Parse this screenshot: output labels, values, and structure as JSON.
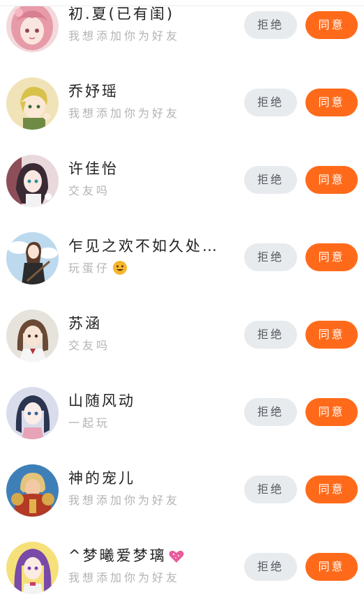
{
  "requests": [
    {
      "name": "初.夏(已有闺)",
      "message": "我想添加你为好友",
      "avatar": "pink-hair-girl-avatar",
      "reject_label": "拒绝",
      "accept_label": "同意"
    },
    {
      "name": "乔妤瑶",
      "message": "我想添加你为好友",
      "avatar": "blonde-boy-avatar",
      "reject_label": "拒绝",
      "accept_label": "同意"
    },
    {
      "name": "许佳怡",
      "message": "交友吗",
      "avatar": "dark-hair-girl-avatar",
      "reject_label": "拒绝",
      "accept_label": "同意"
    },
    {
      "name": "乍见之欢不如久处…",
      "message": "玩蛋仔",
      "message_emoji": "smiling-face-emoji",
      "avatar": "girl-with-guitar-avatar",
      "reject_label": "拒绝",
      "accept_label": "同意"
    },
    {
      "name": "苏涵",
      "message": "交友吗",
      "avatar": "brown-hair-girl-avatar",
      "reject_label": "拒绝",
      "accept_label": "同意"
    },
    {
      "name": "山随风动",
      "message": "一起玩",
      "avatar": "anime-girl-blue-hair-avatar",
      "reject_label": "拒绝",
      "accept_label": "同意"
    },
    {
      "name": "神的宠儿",
      "message": "我想添加你为好友",
      "avatar": "armored-warrior-avatar",
      "reject_label": "拒绝",
      "accept_label": "同意"
    },
    {
      "name": "^梦曦爱梦璃",
      "name_emoji": "sparkling-heart-emoji",
      "message": "我想添加你为好友",
      "avatar": "purple-hair-girl-avatar",
      "reject_label": "拒绝",
      "accept_label": "同意"
    }
  ],
  "colors": {
    "accept": "#ff6a1a",
    "reject_bg": "#e8ebee",
    "reject_text": "#555b61",
    "name_text": "#222222",
    "message_text": "#b3b3b3"
  }
}
